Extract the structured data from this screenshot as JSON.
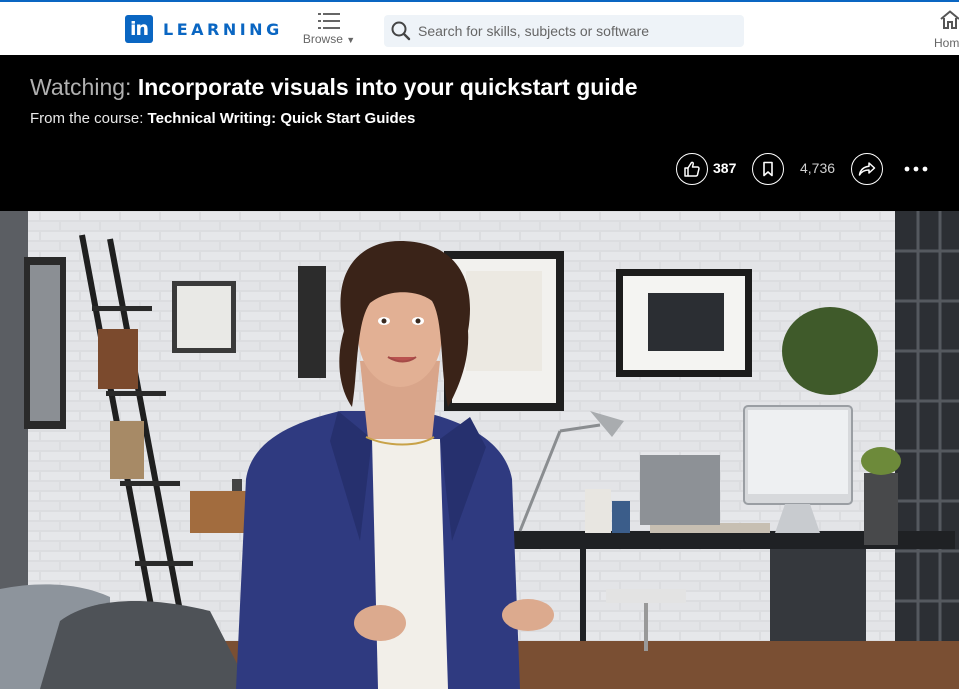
{
  "nav": {
    "logo_badge": "in",
    "logo_text": "LEARNING",
    "browse_label": "Browse",
    "search_placeholder": "Search for skills, subjects or software",
    "home_label": "Home"
  },
  "header": {
    "title_prefix": "Watching:",
    "title": "Incorporate visuals into your quickstart guide",
    "course_prefix": "From the course:",
    "course_name": "Technical Writing: Quick Start Guides"
  },
  "actions": {
    "likes": "387",
    "saves": "4,736"
  },
  "colors": {
    "brand": "#0a66c2",
    "header_bg": "#000000",
    "nav_bg": "#ffffff",
    "search_bg": "#eef3f8"
  }
}
